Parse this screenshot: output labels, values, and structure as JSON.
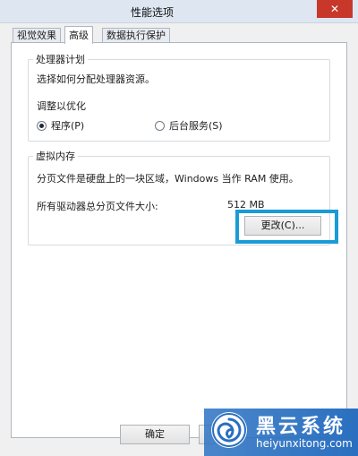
{
  "window": {
    "title": "性能选项",
    "close_glyph": "✕"
  },
  "tabs": [
    {
      "label": "视觉效果",
      "active": false
    },
    {
      "label": "高级",
      "active": true
    },
    {
      "label": "数据执行保护",
      "active": false
    }
  ],
  "processor": {
    "legend": "处理器计划",
    "description": "选择如何分配处理器资源。",
    "adjust_label": "调整以优化",
    "options": [
      {
        "label": "程序(P)",
        "selected": true
      },
      {
        "label": "后台服务(S)",
        "selected": false
      }
    ]
  },
  "virtual_memory": {
    "legend": "虚拟内存",
    "description": "分页文件是硬盘上的一块区域，Windows 当作 RAM 使用。",
    "total_label": "所有驱动器总分页文件大小:",
    "total_value": "512 MB",
    "change_button": "更改(C)...",
    "highlight_color": "#1a9bd7"
  },
  "footer": {
    "ok_button": "确定"
  },
  "watermark": {
    "title": "黑云系统",
    "url": "heiyunxitong.com",
    "logo_icon": "swirl-logo-icon"
  }
}
